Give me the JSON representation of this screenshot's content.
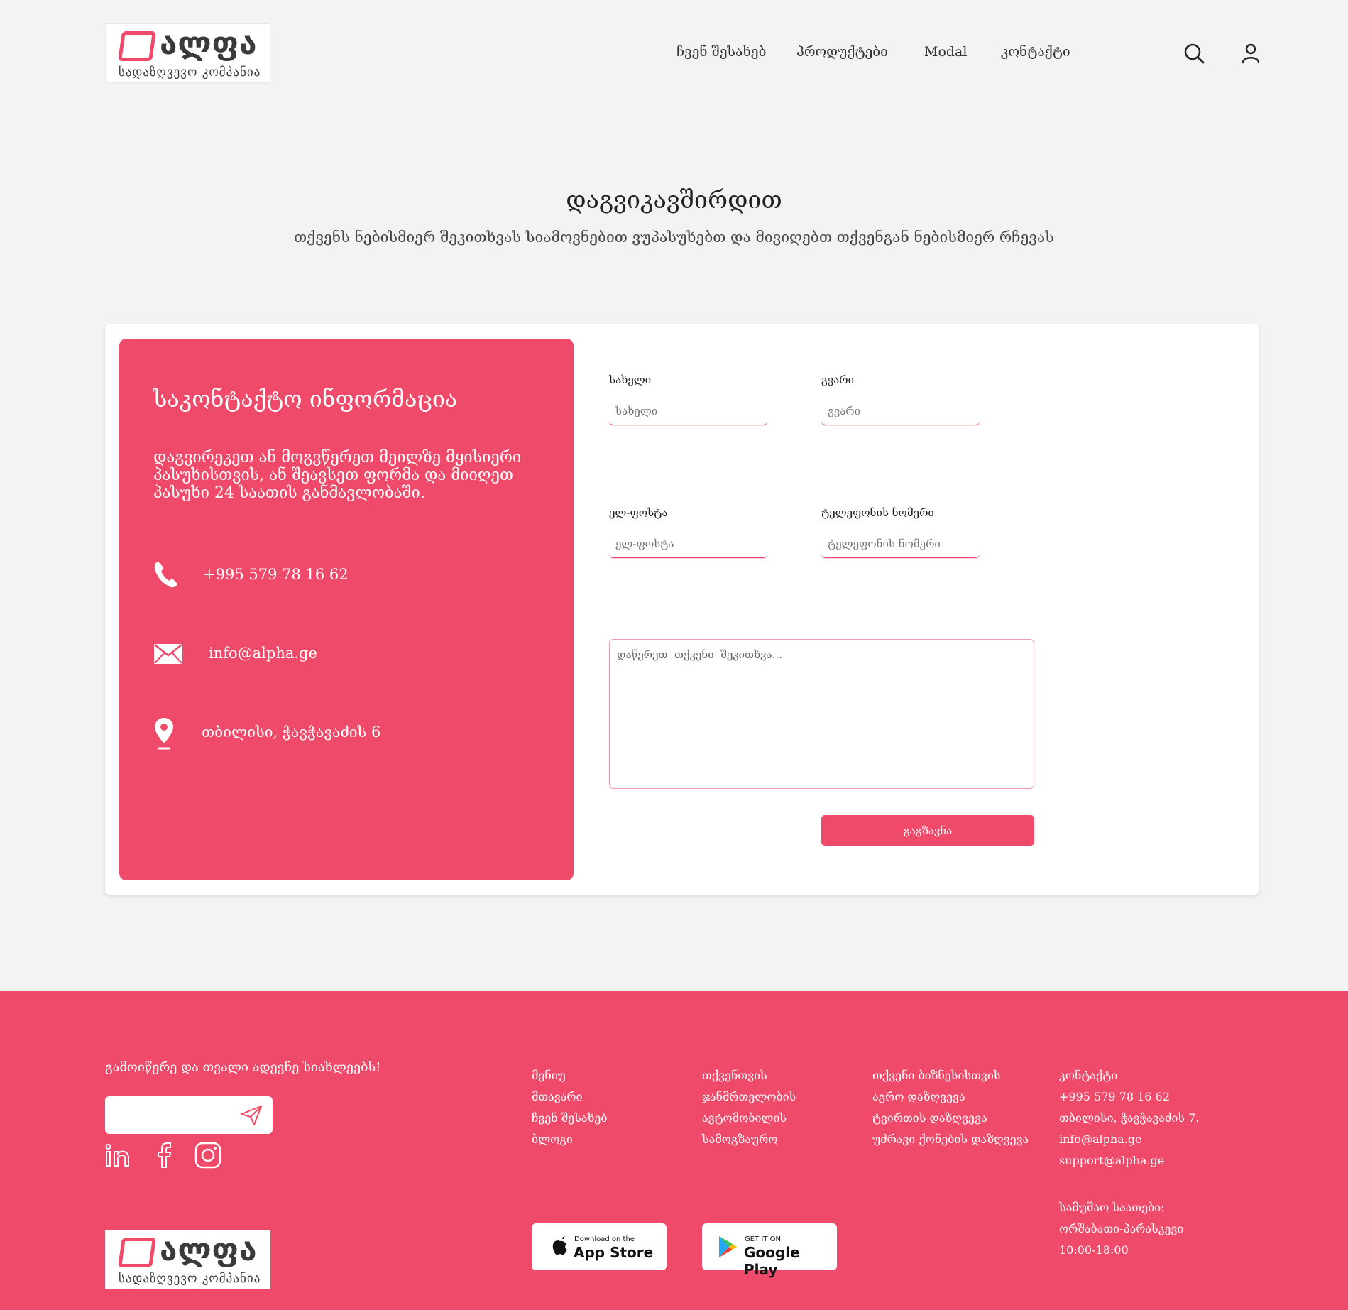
{
  "brand": {
    "logo_word": "ალფა",
    "logo_tagline": "სადაზღვევო კომპანია",
    "accent": "#ef4a6a"
  },
  "nav": {
    "items": [
      "ჩვენ შესახებ",
      "პროდუქტები",
      "Modal",
      "კონტაქტი"
    ],
    "search_icon": "search-icon",
    "user_icon": "user-icon"
  },
  "hero": {
    "title": "დაგვიკავშირდით",
    "subtitle": "თქვენს ნებისმიერ შეკითხვას სიამოვნებით ვუპასუხებთ და მივიღებთ თქვენგან ნებისმიერ რჩევას"
  },
  "contact_info": {
    "title": "საკონტაქტო ინფორმაცია",
    "description": "დაგვირეკეთ ან მოგვწერეთ მეილზე მყისიერი პასუხისთვის, ან შეავსეთ ფორმა და მიიღეთ პასუხი 24 საათის განმავლობაში.",
    "phone": "+995 579 78 16 62",
    "email": "info@alpha.ge",
    "address": "თბილისი, ჭავჭავაძის 6"
  },
  "form": {
    "first_name_label": "სახელი",
    "first_name_placeholder": "სახელი",
    "last_name_label": "გვარი",
    "last_name_placeholder": "გვარი",
    "email_label": "ელ-ფოსტა",
    "email_placeholder": "ელ-ფოსტა",
    "phone_label": "ტელეფონის ნომერი",
    "phone_placeholder": "ტელეფონის ნომერი",
    "message_placeholder": "დაწერეთ  თქვენი  შეკითხვა...",
    "submit_label": "გაგზავნა"
  },
  "footer": {
    "subscribe_title": "გამოიწერე და თვალი ადევნე სიახლეებს!",
    "subscribe_placeholder": "",
    "social": [
      "linkedin-icon",
      "facebook-icon",
      "instagram-icon"
    ],
    "col_menu": [
      "მენიუ",
      "მთავარი",
      "ჩვენ შესახებ",
      "ბლოგი"
    ],
    "col_for_you": [
      "თქვენთვის",
      "ჯანმრთელობის",
      "ავტომობილის",
      "სამოგზაურო"
    ],
    "col_business": [
      "თქვენი ბიზნესისთვის",
      "აგრო დაზღვევა",
      "ტვირთის დაზღვევა",
      "უძრავი ქონების დაზღვევა"
    ],
    "col_contact": [
      "კონტაქტი",
      "+995 579 78 16 62",
      "თბილისი, ჭავჭავაძის 7.",
      "info@alpha.ge",
      "support@alpha.ge"
    ],
    "hours_title": "სამუშაო საათები:",
    "hours_days": "ორშაბათი-პარასკევი",
    "hours_time": "10:00-18:00",
    "app_store_small": "Download on the",
    "app_store_big": "App Store",
    "google_play_small": "GET IT ON",
    "google_play_big": "Google Play"
  }
}
